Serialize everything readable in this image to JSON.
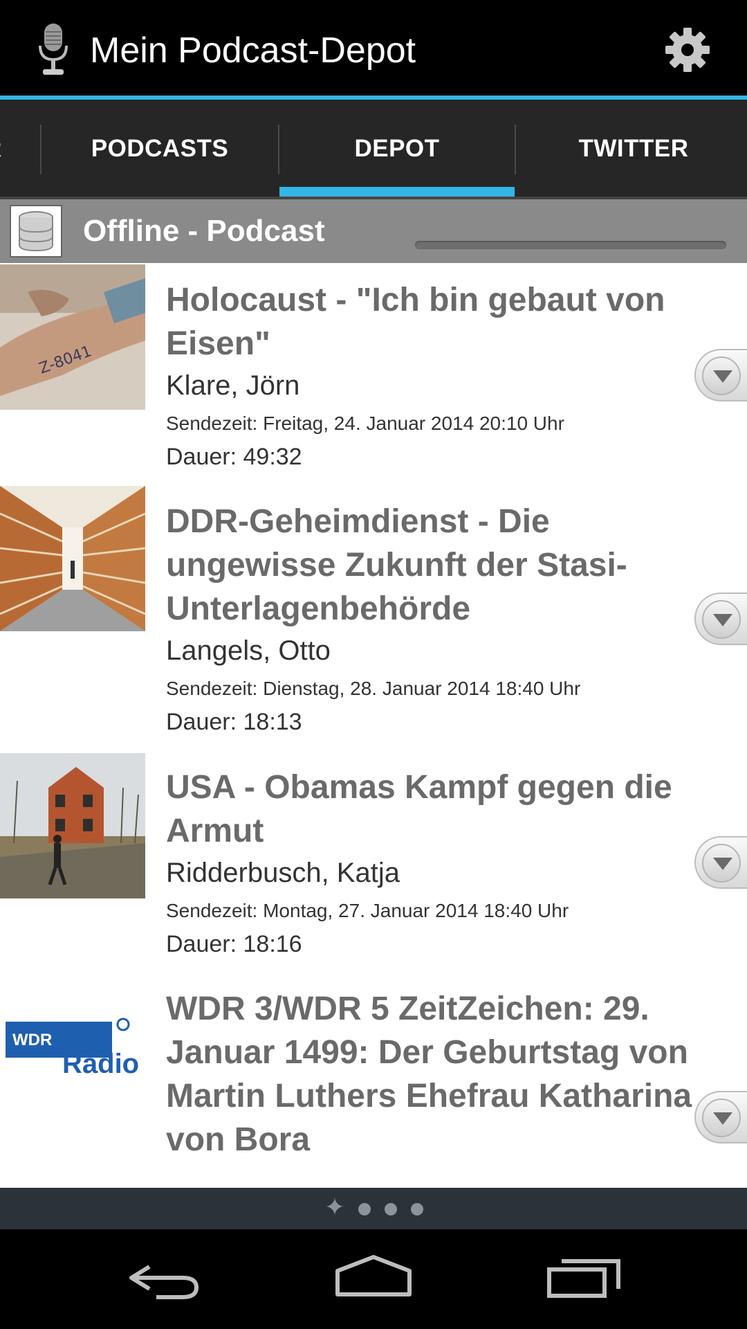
{
  "app": {
    "title": "Mein Podcast-Depot",
    "accent_color": "#33b5e5",
    "icons": {
      "app": "microphone-icon",
      "settings": "gear-icon"
    }
  },
  "tabs": [
    {
      "label": "R"
    },
    {
      "label": "PODCASTS"
    },
    {
      "label": "DEPOT",
      "selected": true
    },
    {
      "label": "TWITTER"
    }
  ],
  "section": {
    "title": "Offline - Podcast",
    "icon": "database-icon"
  },
  "items": [
    {
      "headline": "Holocaust  - \"Ich bin gebaut von Eisen\"",
      "author": "Klare, Jörn",
      "sendezeit": "Sendezeit: Freitag, 24. Januar 2014 20:10 Uhr",
      "dauer": "Dauer: 49:32",
      "thumb": "arm-tattoo-photo"
    },
    {
      "headline": "DDR-Geheimdienst - Die ungewisse Zukunft der Stasi-Unterlagenbehörde",
      "author": "Langels, Otto",
      "sendezeit": "Sendezeit: Dienstag, 28. Januar 2014 18:40 Uhr",
      "dauer": "Dauer: 18:13",
      "thumb": "archive-shelves-photo"
    },
    {
      "headline": "USA  - Obamas Kampf gegen die Armut",
      "author": "Ridderbusch, Katja",
      "sendezeit": "Sendezeit: Montag, 27. Januar 2014 18:40 Uhr",
      "dauer": "Dauer: 18:16",
      "thumb": "ruined-house-photo"
    },
    {
      "headline": "WDR 3/WDR 5 ZeitZeichen: 29. Januar 1499: Der Geburtstag von Martin Luthers Ehefrau Katharina von Bora",
      "thumb": "wdr-radio-logo",
      "logo_text_top": "WDR",
      "logo_text_bottom": "Radio"
    }
  ],
  "pager": {
    "pages": 4,
    "current": 0
  },
  "navbar": {
    "icons": [
      "back-icon",
      "home-icon",
      "recent-apps-icon"
    ]
  }
}
